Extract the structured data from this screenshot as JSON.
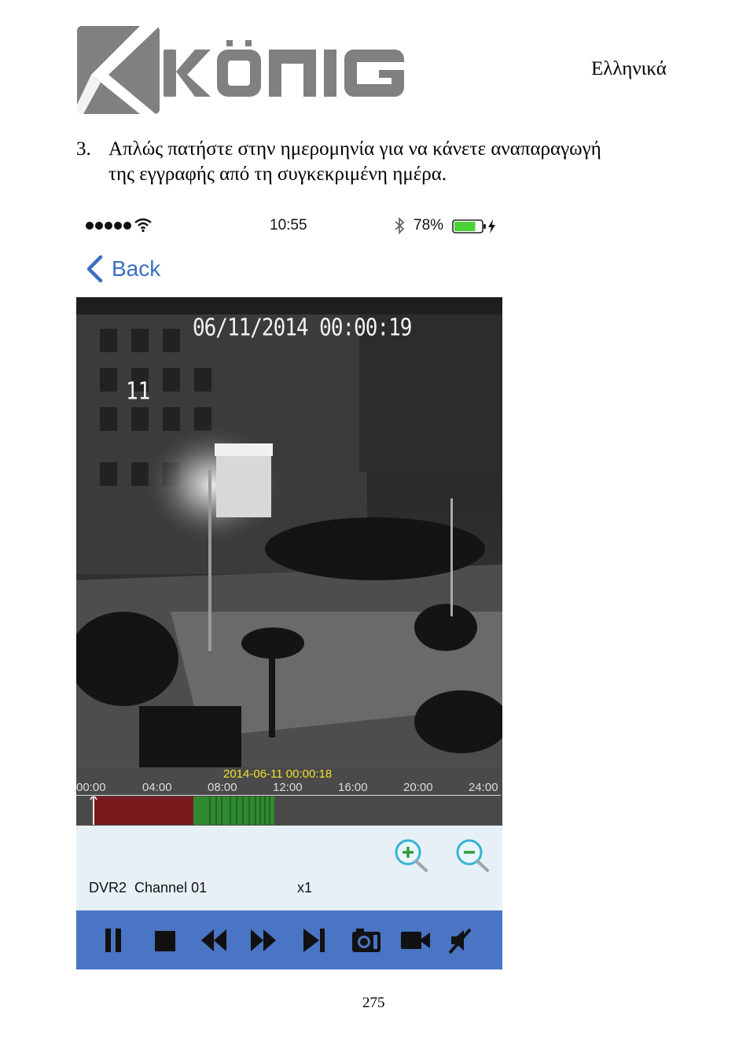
{
  "header": {
    "brand_logo_text": "KÖNIG",
    "language": "Ελληνικά"
  },
  "instruction": {
    "number": "3.",
    "line1": "Απλώς πατήστε στην ημερομηνία για να κάνετε αναπαραγωγή",
    "line2": "της εγγραφής από τη συγκεκριμένη ημέρα."
  },
  "status_bar": {
    "time": "10:55",
    "battery_percent": "78%",
    "battery_level": 0.78,
    "icons": [
      "signal-dots-icon",
      "wifi-icon",
      "bluetooth-icon",
      "battery-icon",
      "charging-bolt-icon"
    ]
  },
  "nav": {
    "back_label": "Back"
  },
  "video": {
    "osd_datetime": "06/11/2014 00:00:19",
    "osd_channel": "11"
  },
  "timeline": {
    "current_timestamp": "2014-06-11 00:00:18",
    "ticks": [
      "00:00",
      "04:00",
      "08:00",
      "12:00",
      "16:00",
      "20:00",
      "24:00"
    ],
    "colors": {
      "red_segment": "#7a1a1e",
      "green_segment": "#2f8a2f",
      "track_bg": "#4a4a4a"
    }
  },
  "info_panel": {
    "device_channel": "DVR2  Channel 01",
    "speed": "x1",
    "icons": [
      "zoom-in-icon",
      "zoom-out-icon"
    ]
  },
  "toolbar": {
    "accent_color": "#4a74c4",
    "icons": [
      "pause-icon",
      "stop-icon",
      "rewind-icon",
      "fast-forward-icon",
      "next-frame-icon",
      "snapshot-icon",
      "record-icon",
      "mute-icon"
    ]
  },
  "footer": {
    "page_number": "275"
  }
}
